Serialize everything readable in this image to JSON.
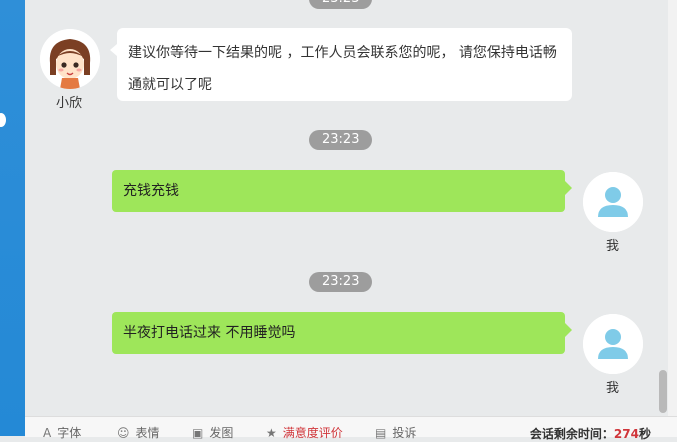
{
  "timestamps": [
    "23:23",
    "23:23",
    "23:23"
  ],
  "agent": {
    "name": "小欣",
    "message": "建议你等待一下结果的呢 ，工作人员会联系您的呢， 请您保持电话畅通就可以了呢"
  },
  "user": {
    "name": "我",
    "messages": [
      "充钱充钱",
      "半夜打电话过来 不用睡觉吗"
    ]
  },
  "toolbar": {
    "font_label": "字体",
    "emoji_label": "表情",
    "screenshot_label": "发图",
    "rating_label": "满意度评价",
    "complaint_label": "投诉",
    "timer_label": "会话剩余时间：",
    "timer_value": "274",
    "timer_unit": "秒"
  },
  "colors": {
    "user_bubble": "#9ee65a",
    "agent_bubble": "#ffffff",
    "timestamp_bg": "#9d9d9d",
    "rating_text": "#d0353a"
  }
}
